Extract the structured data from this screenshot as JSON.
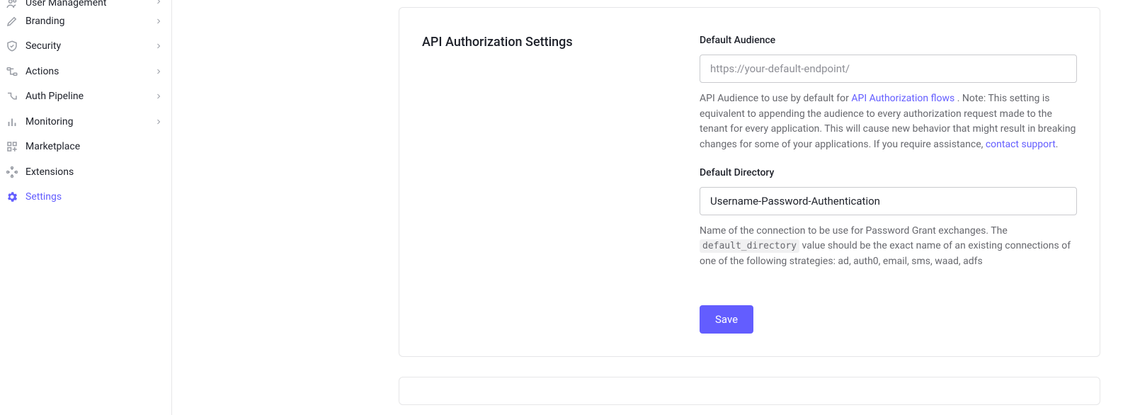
{
  "sidebar": {
    "items": [
      {
        "label": "User Management",
        "icon": "users",
        "chevron": true,
        "active": false
      },
      {
        "label": "Branding",
        "icon": "brush",
        "chevron": true,
        "active": false
      },
      {
        "label": "Security",
        "icon": "shield",
        "chevron": true,
        "active": false
      },
      {
        "label": "Actions",
        "icon": "flow",
        "chevron": true,
        "active": false
      },
      {
        "label": "Auth Pipeline",
        "icon": "pipeline",
        "chevron": true,
        "active": false
      },
      {
        "label": "Monitoring",
        "icon": "bars",
        "chevron": true,
        "active": false
      },
      {
        "label": "Marketplace",
        "icon": "grid",
        "chevron": false,
        "active": false
      },
      {
        "label": "Extensions",
        "icon": "puzzle",
        "chevron": false,
        "active": false
      },
      {
        "label": "Settings",
        "icon": "gear",
        "chevron": false,
        "active": true
      }
    ]
  },
  "panel": {
    "title": "API Authorization Settings",
    "audience": {
      "label": "Default Audience",
      "placeholder": "https://your-default-endpoint/",
      "value": "",
      "help_pre": "API Audience to use by default for ",
      "help_link": "API Authorization flows",
      "help_post": " . Note: This setting is equivalent to appending the audience to every authorization request made to the tenant for every application. This will cause new behavior that might result in breaking changes for some of your applications. If you require assistance, ",
      "help_link2": "contact support",
      "help_tail": "."
    },
    "directory": {
      "label": "Default Directory",
      "value": "Username-Password-Authentication",
      "help_pre": "Name of the connection to be use for Password Grant exchanges. The ",
      "code": "default_directory",
      "help_post": " value should be the exact name of an existing connections of one of the following strategies: ad, auth0, email, sms, waad, adfs"
    },
    "save_label": "Save"
  }
}
